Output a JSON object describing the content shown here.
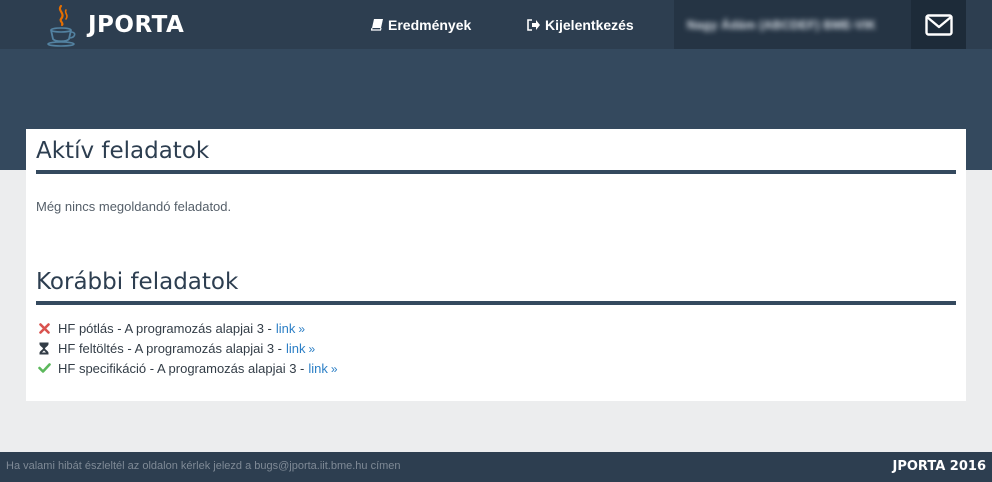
{
  "brand": {
    "name": "JPORTA",
    "icon": "java-coffee-cup-icon"
  },
  "nav": {
    "results_label": "Eredmények",
    "results_icon": "book-icon",
    "logout_label": "Kijelentkezés",
    "logout_icon": "sign-out-icon",
    "user_name": "Nagy Ádám (ABCDEF) BME-VIK",
    "mail_icon": "envelope-icon"
  },
  "active_section": {
    "title": "Aktív feladatok",
    "empty_message": "Még nincs megoldandó feladatod."
  },
  "past_section": {
    "title": "Korábbi feladatok",
    "items": [
      {
        "text": "HF pótlás - A programozás alapjai 3 -",
        "link": "link",
        "arrow": "»",
        "status": "failed",
        "status_icon": "x-mark-icon",
        "status_color": "#d9534f"
      },
      {
        "text": "HF feltöltés - A programozás alapjai 3 -",
        "link": "link",
        "arrow": "»",
        "status": "pending",
        "status_icon": "hourglass-icon",
        "status_color": "#333d47"
      },
      {
        "text": "HF specifikáció - A programozás alapjai 3 -",
        "link": "link",
        "arrow": "»",
        "status": "accepted",
        "status_icon": "check-icon",
        "status_color": "#5cb85c"
      }
    ]
  },
  "footer": {
    "note": "Ha valami hibát észleltél az oldalon kérlek jelezd a bugs@jporta.iit.bme.hu címen",
    "brand": "JPORTA 2016"
  },
  "colors": {
    "navbar": "#2d3e50",
    "hero": "#34495e",
    "link": "#2c7fc6",
    "background": "#ecedee"
  }
}
